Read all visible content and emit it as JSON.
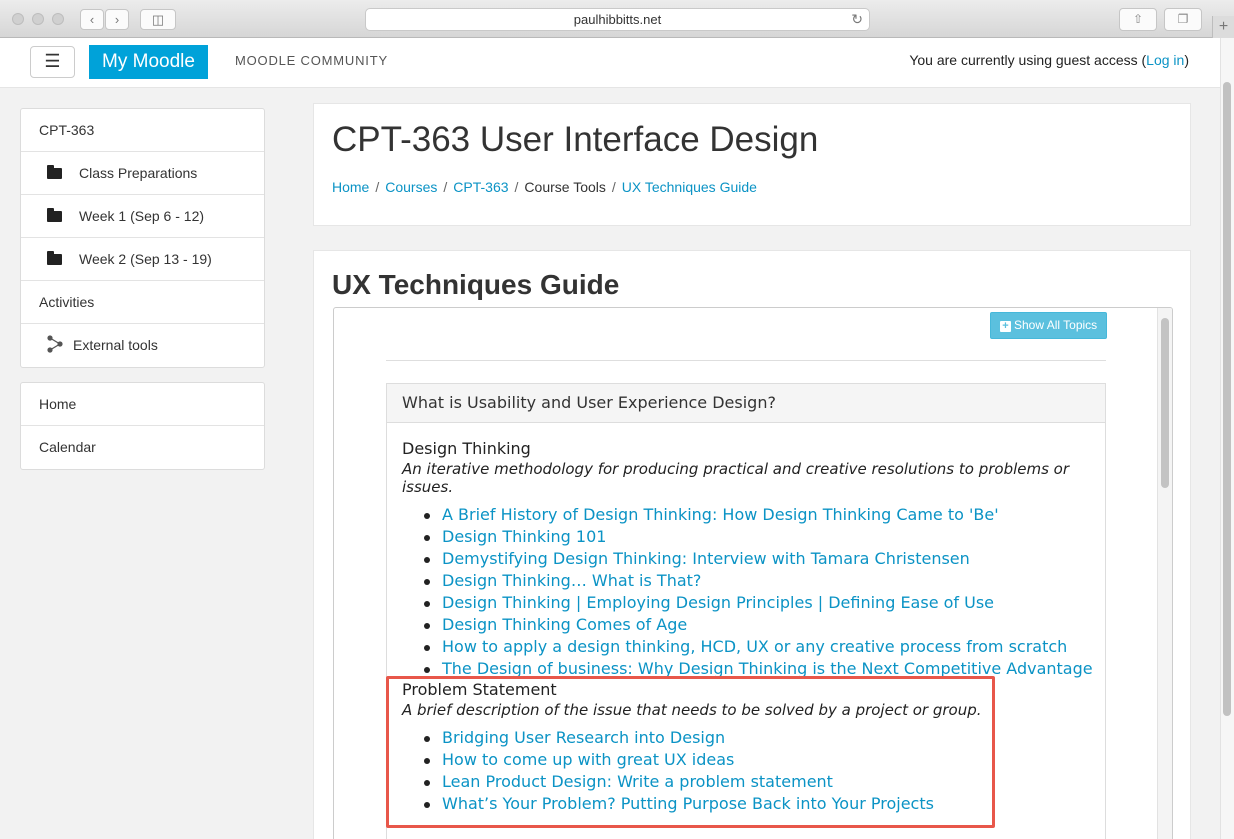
{
  "browser": {
    "url": "paulhibbitts.net"
  },
  "header": {
    "menu_icon": "hamburger-icon",
    "my_moodle": "My Moodle",
    "community": "MOODLE COMMUNITY",
    "guest_text": "You are currently using guest access (",
    "login": "Log in",
    "guest_close": ")"
  },
  "sidebar": {
    "nav": [
      {
        "label": "CPT-363"
      },
      {
        "label": "Class Preparations",
        "icon": "folder-icon"
      },
      {
        "label": "Week 1 (Sep 6 - 12)",
        "icon": "folder-icon"
      },
      {
        "label": "Week 2 (Sep 13 - 19)",
        "icon": "folder-icon"
      },
      {
        "label": "Activities"
      },
      {
        "label": "External tools",
        "icon": "external-tools-icon"
      }
    ],
    "links": [
      {
        "label": "Home"
      },
      {
        "label": "Calendar"
      }
    ]
  },
  "course": {
    "title": "CPT-363 User Interface Design",
    "breadcrumb": [
      "Home",
      "Courses",
      "CPT-363",
      "Course Tools",
      "UX Techniques Guide"
    ]
  },
  "guide": {
    "title": "UX Techniques Guide",
    "show_all": "Show All Topics",
    "panel_heading": "What is Usability and User Experience Design?",
    "sections": [
      {
        "title": "Design Thinking",
        "description": "An iterative methodology for producing practical and creative resolutions to problems or issues.",
        "links": [
          "A Brief History of Design Thinking: How Design Thinking Came to 'Be'",
          "Design Thinking 101",
          "Demystifying Design Thinking: Interview with Tamara Christensen",
          "Design Thinking… What is That?",
          "Design Thinking | Employing Design Principles | Defining Ease of Use",
          "Design Thinking Comes of Age",
          "How to apply a design thinking, HCD, UX or any creative process from scratch",
          "The Design of business: Why Design Thinking is the Next Competitive Advantage"
        ]
      },
      {
        "title": "Problem Statement",
        "description": "A brief description of the issue that needs to be solved by a project or group.",
        "links": [
          "Bridging User Research into Design",
          "How to come up with great UX ideas",
          "Lean Product Design: Write a problem statement",
          "What’s Your Problem? Putting Purpose Back into Your Projects"
        ]
      }
    ]
  },
  "colors": {
    "brand": "#00a2d9",
    "link": "#0b93c5",
    "info_button": "#5bc0de",
    "highlight": "#e8574a"
  }
}
